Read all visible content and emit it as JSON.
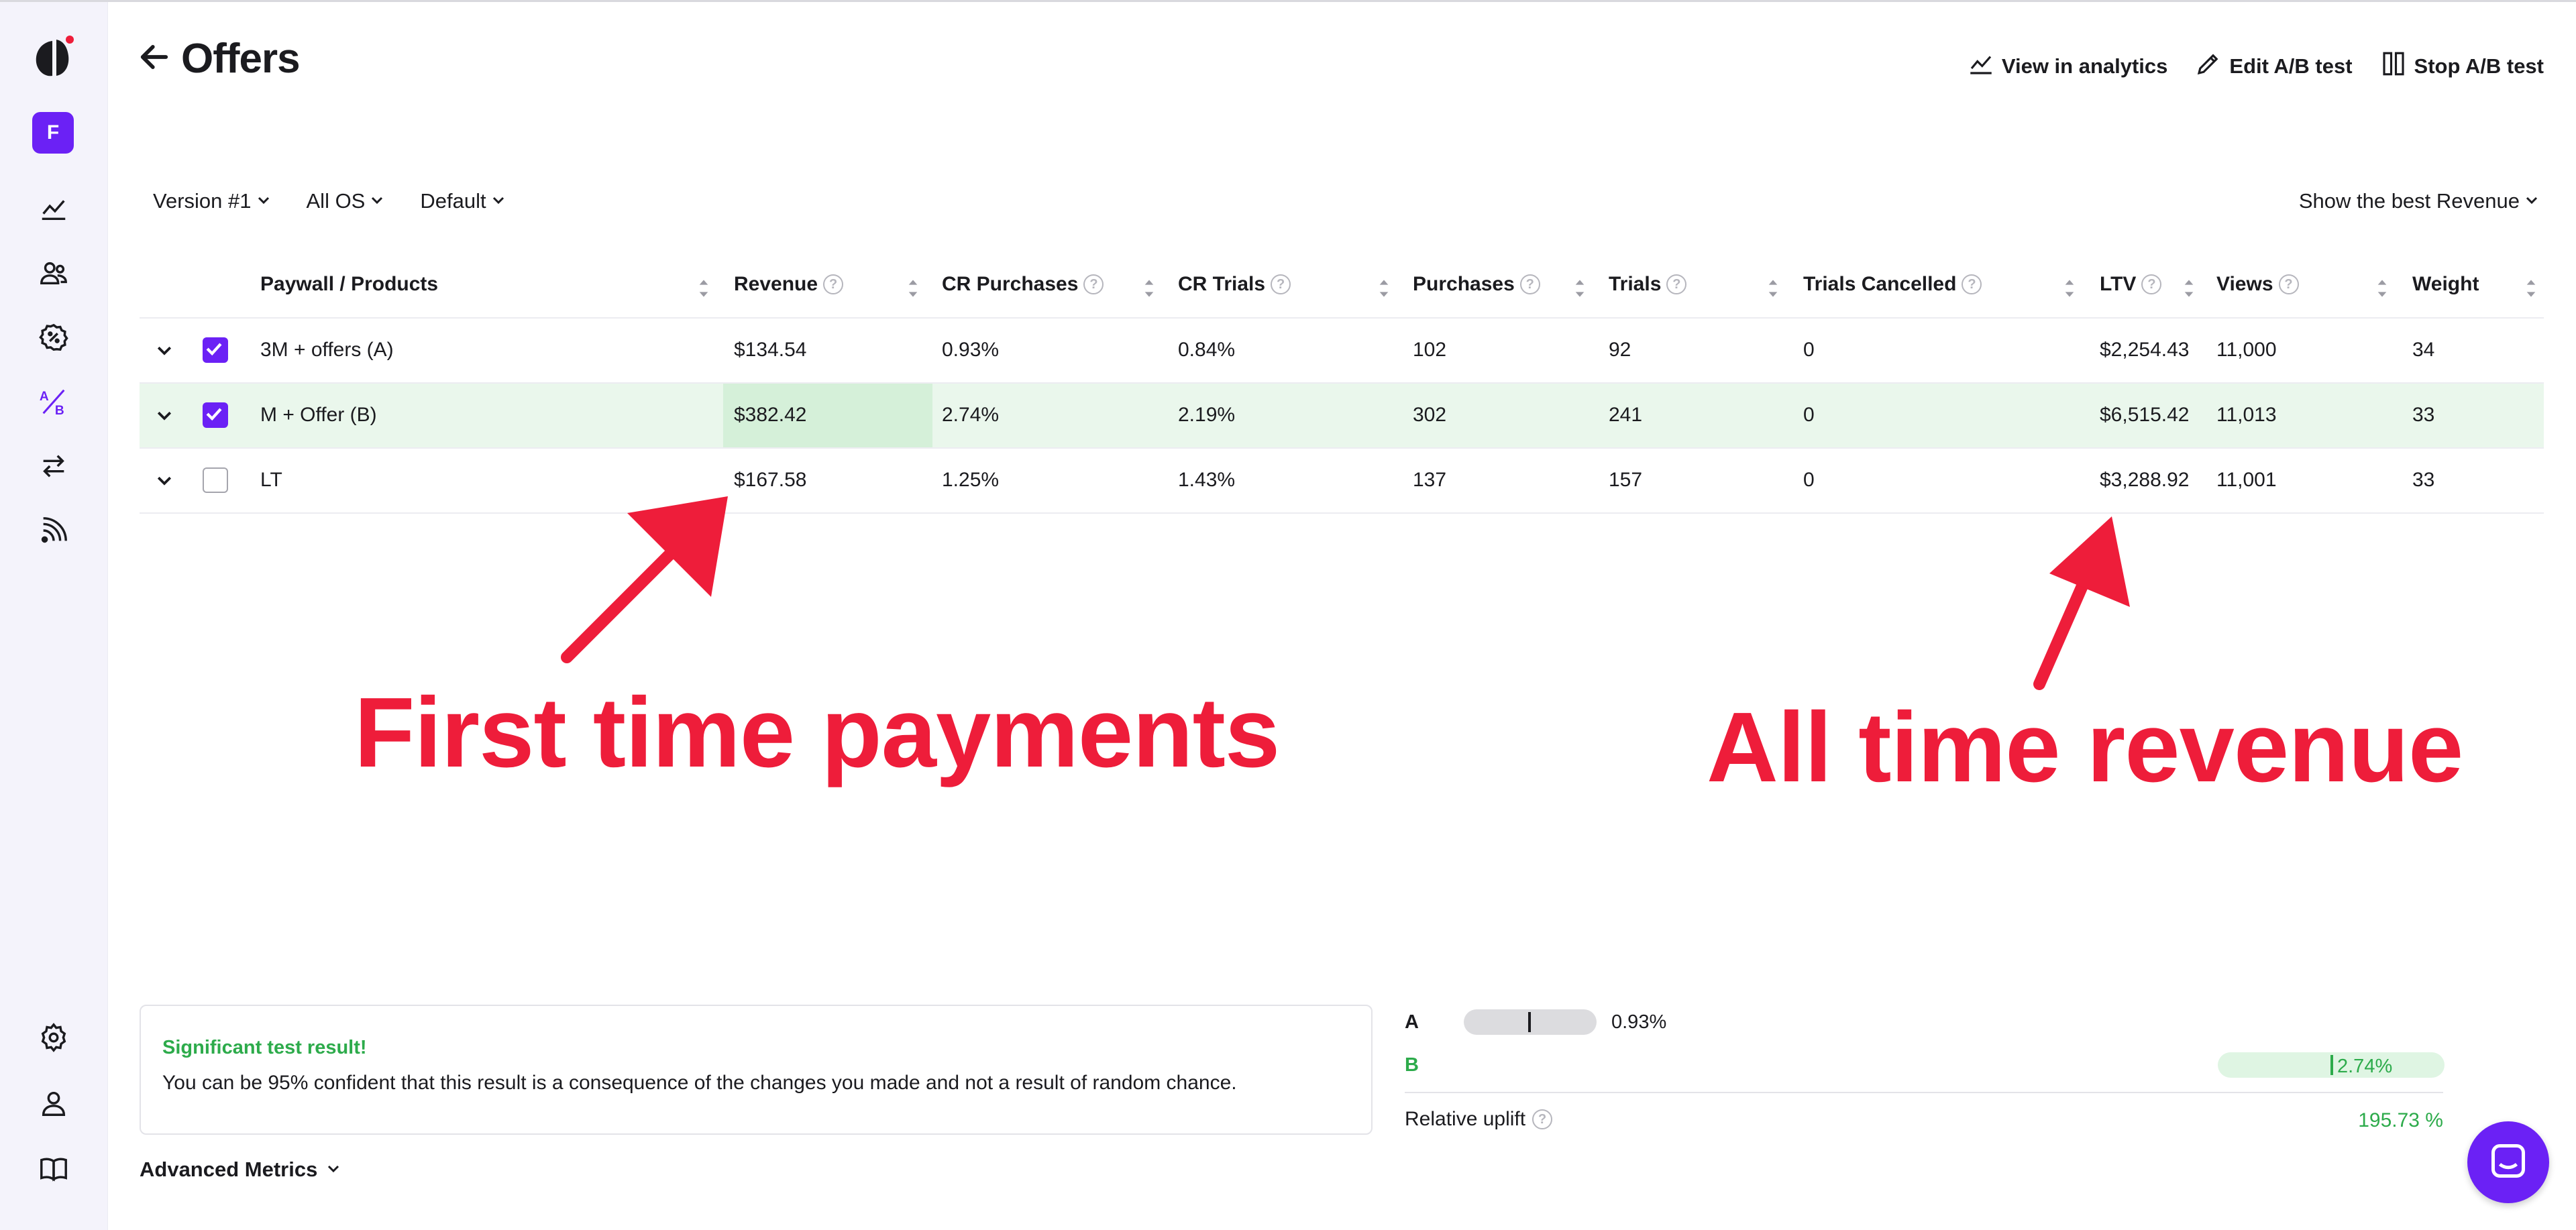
{
  "sidebar": {
    "avatar_letter": "F",
    "ab_label_top": "A",
    "ab_label_bottom": "B"
  },
  "header": {
    "title": "Offers",
    "actions": [
      "View in analytics",
      "Edit A/B test",
      "Stop A/B test"
    ]
  },
  "filters": {
    "version": "Version #1",
    "os": "All OS",
    "placement": "Default",
    "best": "Show the best Revenue"
  },
  "table": {
    "columns": [
      "Paywall / Products",
      "Revenue",
      "CR Purchases",
      "CR Trials",
      "Purchases",
      "Trials",
      "Trials Cancelled",
      "LTV",
      "Views",
      "Weight"
    ],
    "rows": [
      {
        "checked": true,
        "name": "3M + offers (A)",
        "revenue": "$134.54",
        "cr_purchases": "0.93%",
        "cr_trials": "0.84%",
        "purchases": "102",
        "trials": "92",
        "trials_cancelled": "0",
        "ltv": "$2,254.43",
        "views": "11,000",
        "weight": "34"
      },
      {
        "checked": true,
        "winner": true,
        "name": "M + Offer (B)",
        "revenue": "$382.42",
        "cr_purchases": "2.74%",
        "cr_trials": "2.19%",
        "purchases": "302",
        "trials": "241",
        "trials_cancelled": "0",
        "ltv": "$6,515.42",
        "views": "11,013",
        "weight": "33"
      },
      {
        "checked": false,
        "name": "LT",
        "revenue": "$167.58",
        "cr_purchases": "1.25%",
        "cr_trials": "1.43%",
        "purchases": "137",
        "trials": "157",
        "trials_cancelled": "0",
        "ltv": "$3,288.92",
        "views": "11,001",
        "weight": "33"
      }
    ]
  },
  "annotations": {
    "left": "First time payments",
    "right": "All time revenue"
  },
  "result": {
    "title": "Significant test result!",
    "text": "You can be 95% confident that this result is a consequence of the changes you made and not a result of random chance."
  },
  "advanced_metrics": "Advanced Metrics",
  "uplift": {
    "a_label": "A",
    "a_value": "0.93%",
    "b_label": "B",
    "b_value": "2.74%",
    "relative_label": "Relative uplift",
    "relative_value": "195.73 %"
  },
  "colors": {
    "accent": "#6b21f5",
    "success": "#2dab4b",
    "annotation": "#ee1d3a"
  }
}
